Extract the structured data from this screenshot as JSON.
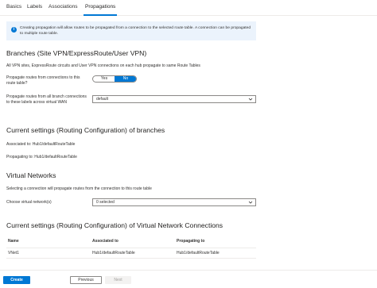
{
  "tabs": [
    {
      "label": "Basics"
    },
    {
      "label": "Labels"
    },
    {
      "label": "Associations"
    },
    {
      "label": "Propagations",
      "active": true
    }
  ],
  "info": {
    "text": "Creating propagation will allow routes to be propagated from a connection to the selected route table. A connection can be propagated to multiple route table."
  },
  "branches": {
    "title": "Branches (Site VPN/ExpressRoute/User VPN)",
    "description": "All VPN sites, ExpressRoute circuits and User VPN connections on each hub propagate to same Route Tables",
    "propagate_label": "Propagate routes from connections to this route table?",
    "toggle": {
      "yes": "Yes",
      "no": "No",
      "selected": "No"
    },
    "labels_label": "Propagate routes from all branch connections to these labels across virtual WAN",
    "labels_value": "default"
  },
  "current_branches": {
    "title": "Current settings (Routing Configuration) of branches",
    "associated": "Associated to: Hub1/defaultRouteTable",
    "propagating": "Propagating to: Hub1/defaultRouteTable"
  },
  "vnets": {
    "title": "Virtual Networks",
    "description": "Selecting a connection will propagate routes from the connection to this route table",
    "choose_label": "Choose virtual network(s)",
    "choose_value": "0 selected"
  },
  "current_vnets": {
    "title": "Current settings (Routing Configuration) of Virtual Network Connections",
    "columns": [
      "Name",
      "Associated to",
      "Propagating to"
    ],
    "rows": [
      [
        "VNet1",
        "Hub1/defaultRouteTable",
        "Hub1/defaultRouteTable"
      ]
    ]
  },
  "footer": {
    "create": "Create",
    "previous": "Previous",
    "next": "Next"
  },
  "colors": {
    "accent": "#0078d4",
    "info_bg": "#ebf3fc"
  }
}
